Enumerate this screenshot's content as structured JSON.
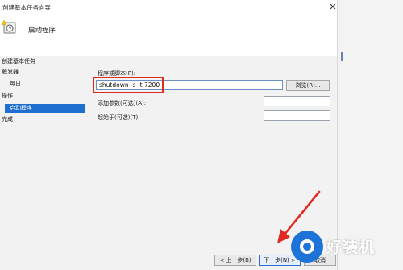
{
  "window": {
    "title": "创建基本任务向导",
    "close_glyph": "✕"
  },
  "header": {
    "icon": "task-scheduler-icon",
    "title": "启动程序"
  },
  "sidebar": {
    "items": [
      {
        "label": "创建基本任务"
      },
      {
        "label": "触发器"
      },
      {
        "label": "每日"
      },
      {
        "label": "操作"
      },
      {
        "label": "启动程序"
      },
      {
        "label": "完成"
      }
    ],
    "active_index": 4
  },
  "form": {
    "program_label": "程序或脚本(P):",
    "program_value": "shutdown -s -t 7200",
    "browse_label": "浏览(R)...",
    "args_label": "添加参数(可选)(A):",
    "args_value": "",
    "startin_label": "起始于(可选)(T):",
    "startin_value": ""
  },
  "footer": {
    "back_label": "< 上一步(B)",
    "next_label": "下一步(N) >",
    "cancel_label": "取消"
  },
  "annotation": {
    "highlight_color": "#e02a20",
    "arrow_color": "#e02a20"
  },
  "watermark": {
    "text": "好装机",
    "color": "#1e73d8"
  }
}
